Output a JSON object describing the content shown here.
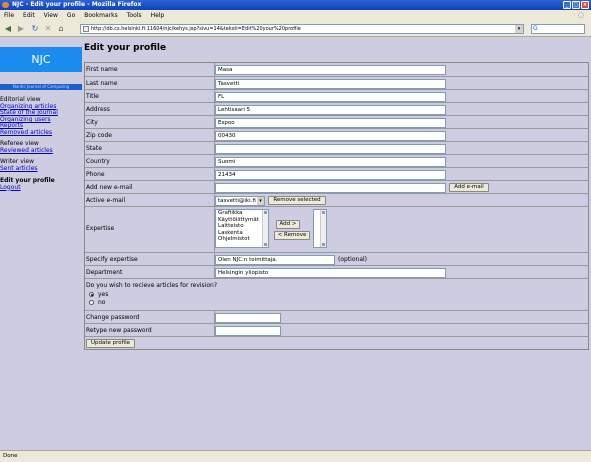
{
  "window": {
    "title": "NJC - Edit your profile - Mozilla Firefox"
  },
  "menu": [
    "File",
    "Edit",
    "View",
    "Go",
    "Bookmarks",
    "Tools",
    "Help"
  ],
  "nav": {
    "url": "http://db.cs.helsinki.fi:11604/njc/kehys.jsp?sivu=14&teksti=Edit%20your%20profile"
  },
  "sidebar": {
    "logo": "NJC",
    "logo_sub": "Nordic Journal of Computing",
    "editorial_head": "Editorial view",
    "editorial_links": [
      "Organizing articles",
      "State of the journal",
      "Organizing users",
      "Reports",
      "Removed articles"
    ],
    "referee_head": "Referee view",
    "referee_links": [
      "Reviewed articles"
    ],
    "writer_head": "Writer view",
    "writer_links": [
      "Sent articles"
    ],
    "edit_profile": "Edit your profile",
    "logout": "Logout"
  },
  "page": {
    "title": "Edit your profile"
  },
  "form": {
    "first_name": {
      "label": "First name",
      "value": "Masa"
    },
    "last_name": {
      "label": "Last name",
      "value": "Tasvetti"
    },
    "title": {
      "label": "Title",
      "value": "FL"
    },
    "address": {
      "label": "Address",
      "value": "Lehtisaari 5"
    },
    "city": {
      "label": "City",
      "value": "Espoo"
    },
    "zip": {
      "label": "Zip code",
      "value": "00430"
    },
    "state": {
      "label": "State",
      "value": ""
    },
    "country": {
      "label": "Country",
      "value": "Suomi"
    },
    "phone": {
      "label": "Phone",
      "value": "21434"
    },
    "add_email": {
      "label": "Add new e-mail",
      "value": "",
      "button": "Add e-mail"
    },
    "active_email": {
      "label": "Active e-mail",
      "value": "tasvetti@iki.fi",
      "button": "Remove selected"
    },
    "expertise": {
      "label": "Expertise",
      "options": [
        "Grafiikka",
        "Käyttöliittymät",
        "Laitteisto",
        "Laskenta",
        "Ohjelmistot"
      ],
      "add": "Add >",
      "remove": "< Remove"
    },
    "specify": {
      "label": "Specify expertise",
      "value": "Olen NJC:n toimittaja.",
      "note": "(optional)"
    },
    "department": {
      "label": "Department",
      "value": "Helsingin yliopisto"
    },
    "revision": {
      "question": "Do you wish to recieve articles for revision?",
      "yes": "yes",
      "no": "no"
    },
    "change_password": {
      "label": "Change password"
    },
    "retype_password": {
      "label": "Retype new password"
    },
    "update": "Update profile"
  },
  "status": "Done"
}
